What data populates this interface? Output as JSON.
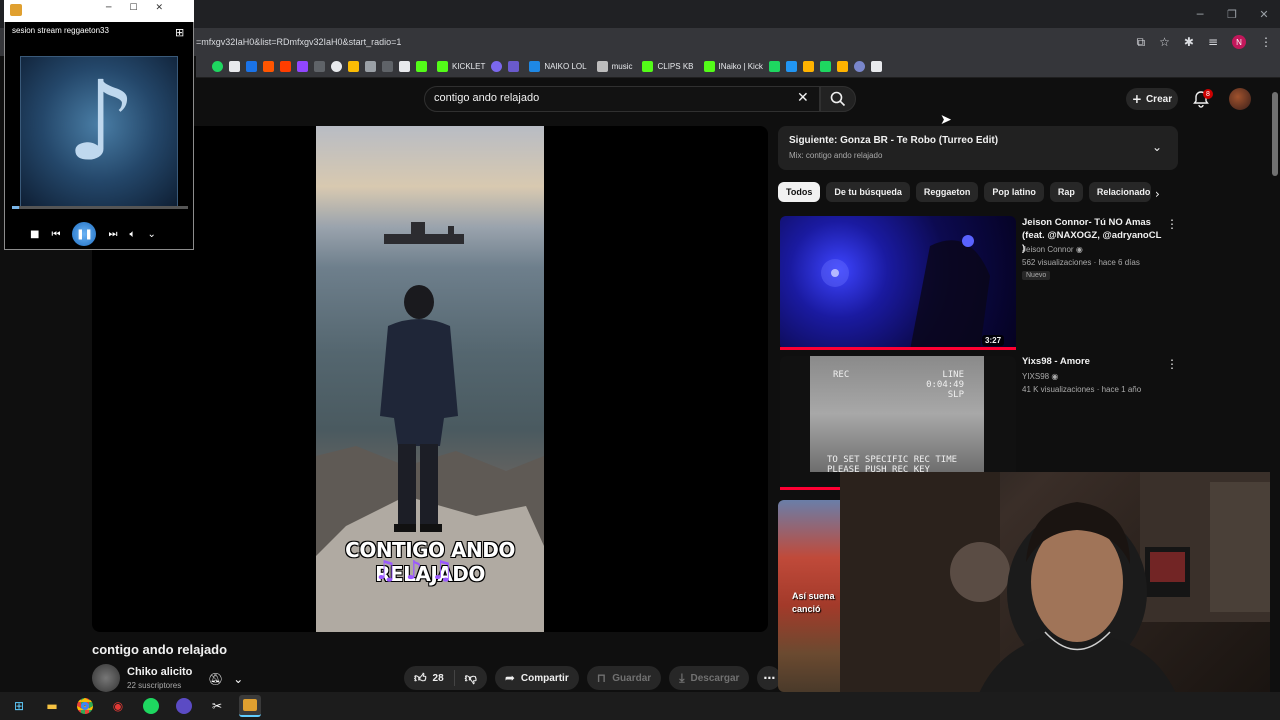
{
  "browser": {
    "url": "=mfxgv32IaH0&list=RDmfxgv32IaH0&start_radio=1",
    "profile_initial": "N",
    "bookmarks": [
      {
        "label": "KICKLET",
        "color": "#53fc18"
      },
      {
        "label": "NAIKO LOL",
        "color": "#1e88e5"
      },
      {
        "label": "music",
        "color": "#bdbdbd"
      },
      {
        "label": "CLIPS KB",
        "color": "#53fc18"
      },
      {
        "label": "INaiko | Kick",
        "color": "#53fc18"
      }
    ]
  },
  "youtube": {
    "search_value": "contigo ando relajado",
    "create_label": "Crear",
    "notifications_count": "8",
    "video": {
      "title": "contigo ando relajado",
      "overlay_text": "CONTIGO ANDO RELAJADO",
      "channel": "Chiko alicito",
      "subscribers": "22 suscriptores",
      "likes": "28",
      "share_label": "Compartir",
      "save_label": "Guardar",
      "download_label": "Descargar"
    },
    "next": {
      "title": "Siguiente: Gonza BR - Te Robo (Turreo Edit)",
      "subtitle": "Mix: contigo ando relajado"
    },
    "chips": [
      "Todos",
      "De tu búsqueda",
      "Reggaeton",
      "Pop latino",
      "Rap",
      "Relacionado"
    ],
    "recommended": [
      {
        "title": "Jeison Connor- Tú NO Amas (feat. @NAXOGZ, @adryanoCL )",
        "channel": "Jeison Connor",
        "meta": "562 visualizaciones · hace 6 días",
        "badge": "Nuevo",
        "duration": "3:27"
      },
      {
        "title": "Yixs98 - Amore",
        "channel": "YIXS98",
        "meta": "41 K visualizaciones · hace 1 año",
        "vhs_rec": "REC",
        "vhs_line": "LINE",
        "vhs_time": "0:04:49",
        "vhs_slp": "SLP",
        "vhs_bottom1": "TO SET SPECIFIC REC TIME",
        "vhs_bottom2": "PLEASE PUSH REC KEY"
      },
      {
        "overlay": "Así suena canció"
      }
    ]
  },
  "media_player": {
    "track": "sesion stream reggaeton33",
    "progress_fraction": 0.04
  }
}
